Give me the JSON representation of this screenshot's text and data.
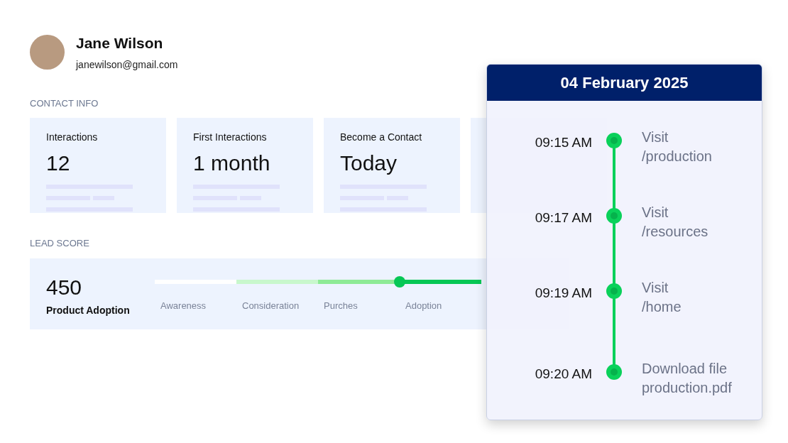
{
  "profile": {
    "name": "Jane Wilson",
    "email": "janewilson@gmail.com"
  },
  "contact_info": {
    "heading": "CONTACT INFO",
    "cards": [
      {
        "label": "Interactions",
        "value": "12",
        "faded": false
      },
      {
        "label": "First Interactions",
        "value": "1 month",
        "faded": false
      },
      {
        "label": "Become a Contact",
        "value": "Today",
        "faded": false
      }
    ]
  },
  "lead_score": {
    "heading": "LEAD SCORE",
    "score": "450",
    "stage_name": "Product Adoption",
    "stages": [
      {
        "label": "Awareness",
        "color": "#ffffff",
        "selected": false
      },
      {
        "label": "Consideration",
        "color": "#c8f7cc",
        "selected": false
      },
      {
        "label": "Purches",
        "color": "#8eea96",
        "selected": false
      },
      {
        "label": "Adoption",
        "color": "#06c755",
        "selected": true
      }
    ]
  },
  "timeline": {
    "date": "04 February 2025",
    "events": [
      {
        "time": "09:15 AM",
        "action": "Visit",
        "detail": "/production"
      },
      {
        "time": "09:17 AM",
        "action": "Visit",
        "detail": "/resources"
      },
      {
        "time": "09:19 AM",
        "action": "Visit",
        "detail": "/home"
      },
      {
        "time": "09:20 AM",
        "action": "Download file",
        "detail": "production.pdf"
      }
    ]
  }
}
